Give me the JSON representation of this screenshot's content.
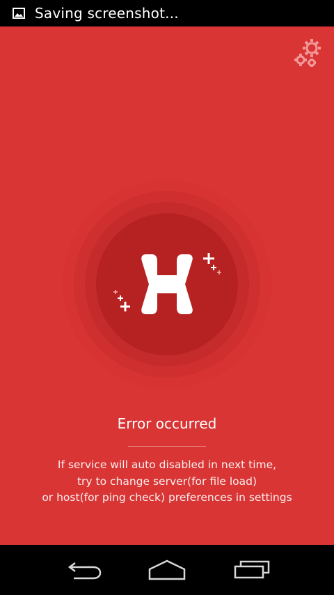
{
  "status_bar": {
    "text": "Saving screenshot...",
    "icon": "image-icon"
  },
  "main": {
    "settings_icon": "gears-icon",
    "logo_icon": "h-logo-icon",
    "title": "Error occurred",
    "message_lines": [
      "If service will auto disabled in next time,",
      "try to change server(for file load)",
      "or host(for ping check) preferences in settings"
    ],
    "colors": {
      "background": "#d93535",
      "circle": "#b62222",
      "text": "#ffffff"
    }
  },
  "nav_bar": {
    "back_icon": "back-icon",
    "home_icon": "home-icon",
    "recents_icon": "recents-icon"
  }
}
